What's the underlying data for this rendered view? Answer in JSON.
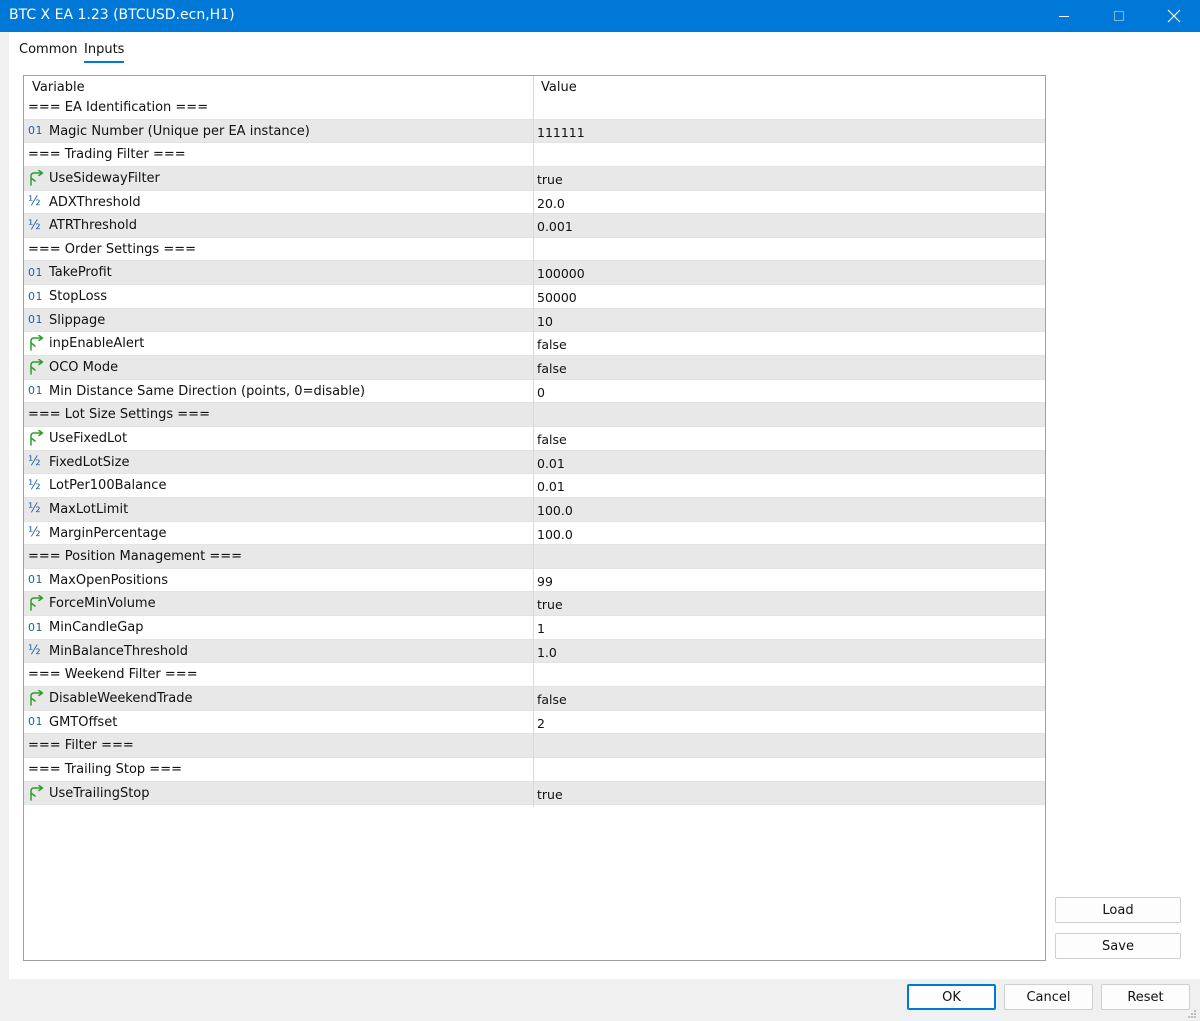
{
  "window": {
    "title": "BTC X EA 1.23 (BTCUSD.ecn,H1)",
    "accent_color": "#0078d7"
  },
  "tabs": [
    {
      "label": "Common",
      "active": false
    },
    {
      "label": "Inputs",
      "active": true
    }
  ],
  "grid": {
    "headers": {
      "variable": "Variable",
      "value": "Value"
    },
    "rows": [
      {
        "type": "section",
        "name": "=== EA Identification ===",
        "value": ""
      },
      {
        "type": "int",
        "icon": "integer-icon",
        "icon_text": "01",
        "name": "Magic Number (Unique per EA instance)",
        "value": "111111"
      },
      {
        "type": "section",
        "name": "=== Trading Filter ===",
        "value": ""
      },
      {
        "type": "bool",
        "icon": "bool-arrow-icon",
        "name": "UseSidewayFilter",
        "value": "true"
      },
      {
        "type": "double",
        "icon": "fraction-icon",
        "icon_text": "½",
        "name": "ADXThreshold",
        "value": "20.0"
      },
      {
        "type": "double",
        "icon": "fraction-icon",
        "icon_text": "½",
        "name": "ATRThreshold",
        "value": "0.001"
      },
      {
        "type": "section",
        "name": "=== Order Settings ===",
        "value": ""
      },
      {
        "type": "int",
        "icon": "integer-icon",
        "icon_text": "01",
        "name": "TakeProfit",
        "value": "100000"
      },
      {
        "type": "int",
        "icon": "integer-icon",
        "icon_text": "01",
        "name": "StopLoss",
        "value": "50000"
      },
      {
        "type": "int",
        "icon": "integer-icon",
        "icon_text": "01",
        "name": "Slippage",
        "value": "10"
      },
      {
        "type": "bool",
        "icon": "bool-arrow-icon",
        "name": "inpEnableAlert",
        "value": "false"
      },
      {
        "type": "bool",
        "icon": "bool-arrow-icon",
        "name": "OCO Mode",
        "value": "false"
      },
      {
        "type": "int",
        "icon": "integer-icon",
        "icon_text": "01",
        "name": "Min Distance Same Direction (points, 0=disable)",
        "value": "0"
      },
      {
        "type": "section",
        "name": "=== Lot Size Settings ===",
        "value": ""
      },
      {
        "type": "bool",
        "icon": "bool-arrow-icon",
        "name": "UseFixedLot",
        "value": "false"
      },
      {
        "type": "double",
        "icon": "fraction-icon",
        "icon_text": "½",
        "name": "FixedLotSize",
        "value": "0.01"
      },
      {
        "type": "double",
        "icon": "fraction-icon",
        "icon_text": "½",
        "name": "LotPer100Balance",
        "value": "0.01"
      },
      {
        "type": "double",
        "icon": "fraction-icon",
        "icon_text": "½",
        "name": "MaxLotLimit",
        "value": "100.0"
      },
      {
        "type": "double",
        "icon": "fraction-icon",
        "icon_text": "½",
        "name": "MarginPercentage",
        "value": "100.0"
      },
      {
        "type": "section",
        "name": "=== Position Management ===",
        "value": ""
      },
      {
        "type": "int",
        "icon": "integer-icon",
        "icon_text": "01",
        "name": "MaxOpenPositions",
        "value": "99"
      },
      {
        "type": "bool",
        "icon": "bool-arrow-icon",
        "name": "ForceMinVolume",
        "value": "true"
      },
      {
        "type": "int",
        "icon": "integer-icon",
        "icon_text": "01",
        "name": "MinCandleGap",
        "value": "1"
      },
      {
        "type": "double",
        "icon": "fraction-icon",
        "icon_text": "½",
        "name": "MinBalanceThreshold",
        "value": "1.0"
      },
      {
        "type": "section",
        "name": "=== Weekend Filter ===",
        "value": ""
      },
      {
        "type": "bool",
        "icon": "bool-arrow-icon",
        "name": "DisableWeekendTrade",
        "value": "false"
      },
      {
        "type": "int",
        "icon": "integer-icon",
        "icon_text": "01",
        "name": "GMTOffset",
        "value": "2"
      },
      {
        "type": "section",
        "name": "=== Filter ===",
        "value": ""
      },
      {
        "type": "section",
        "name": "=== Trailing Stop ===",
        "value": ""
      },
      {
        "type": "bool",
        "icon": "bool-arrow-icon",
        "name": "UseTrailingStop",
        "value": "true"
      }
    ]
  },
  "side_buttons": {
    "load": "Load",
    "save": "Save"
  },
  "footer": {
    "ok": "OK",
    "cancel": "Cancel",
    "reset": "Reset"
  },
  "colors": {
    "row_alt": "#e8e8e8",
    "int_icon": "#1f5fa8",
    "bool_icon": "#2aa02a"
  }
}
